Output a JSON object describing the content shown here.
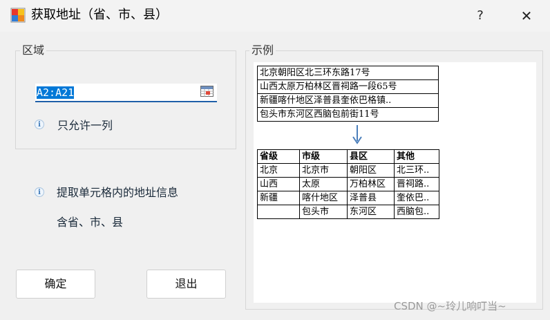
{
  "window": {
    "title": "获取地址（省、市、县）",
    "help_label": "?",
    "close_label": "✕"
  },
  "range_group": {
    "legend": "区域",
    "input_value": "A2:A21",
    "hint": "只允许一列"
  },
  "description": {
    "line1": "提取单元格内的地址信息",
    "line2": "含省、市、县"
  },
  "buttons": {
    "ok": "确定",
    "exit": "退出"
  },
  "example_group": {
    "legend": "示例",
    "source_rows": [
      "北京朝阳区北三环东路17号",
      "山西太原万柏林区晋祠路一段65号",
      "新疆喀什地区泽普县奎依巴格镇..",
      "包头市东河区西脑包前街11号"
    ],
    "result_headers": [
      "省级",
      "市级",
      "县区",
      "其他"
    ],
    "result_rows": [
      [
        "北京",
        "北京市",
        "朝阳区",
        "北三环.."
      ],
      [
        "山西",
        "太原",
        "万柏林区",
        "晋祠路.."
      ],
      [
        "新疆",
        "喀什地区",
        "泽普县",
        "奎依巴.."
      ],
      [
        "",
        "包头市",
        "东河区",
        "西脑包.."
      ]
    ]
  },
  "watermark": "CSDN @~玲儿响叮当~",
  "colors": {
    "input_underline": "#1f5fa8",
    "arrow": "#4a7ebb",
    "selection": "#0078d7"
  }
}
